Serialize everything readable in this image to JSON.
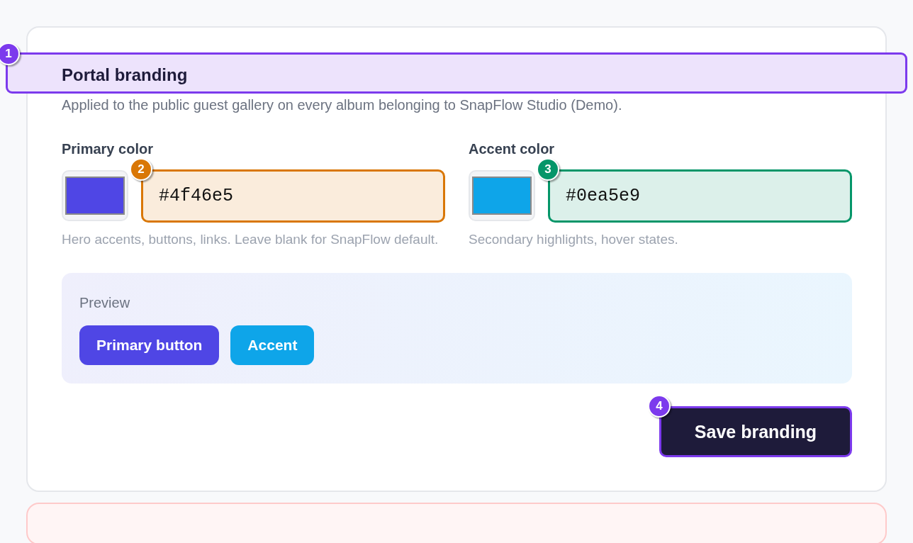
{
  "header": {
    "title": "Portal branding",
    "subtitle": "Applied to the public guest gallery on every album belonging to SnapFlow Studio (Demo).",
    "annotation": {
      "number": "1",
      "color": "#7c3aed"
    }
  },
  "fields": [
    {
      "label": "Primary color",
      "color": "#4f46e5",
      "value": "#4f46e5",
      "hint": "Hero accents, buttons, links. Leave blank for SnapFlow default.",
      "annotation": {
        "number": "2",
        "color": "#d97706"
      }
    },
    {
      "label": "Accent color",
      "color": "#0ea5e9",
      "value": "#0ea5e9",
      "hint": "Secondary highlights, hover states.",
      "annotation": {
        "number": "3",
        "color": "#059669"
      }
    }
  ],
  "preview": {
    "label": "Preview",
    "buttons": [
      {
        "label": "Primary button",
        "color": "#4f46e5"
      },
      {
        "label": "Accent",
        "color": "#0ea5e9"
      }
    ]
  },
  "save_button": {
    "label": "Save branding",
    "annotation": {
      "number": "4",
      "color": "#7c3aed"
    }
  }
}
